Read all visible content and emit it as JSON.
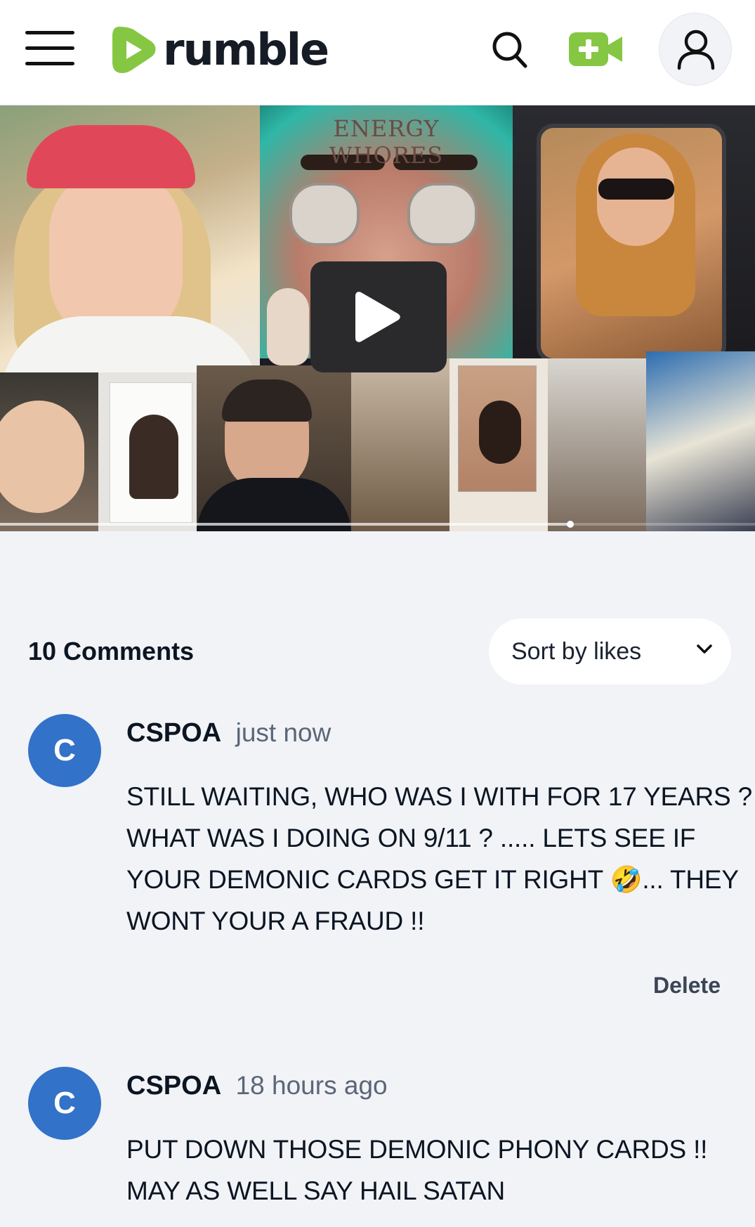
{
  "header": {
    "logo_text": "rumble",
    "brand_color": "#85c742",
    "icons": [
      "menu-icon",
      "search-icon",
      "upload-video-icon",
      "user-icon"
    ]
  },
  "video": {
    "thumbnail_caption": "ENERGY WHORES",
    "progress": 0.755
  },
  "comments": {
    "count_label": "10 Comments",
    "sort_selected": "Sort by likes",
    "items": [
      {
        "avatar_letter": "C",
        "username": "CSPOA",
        "time": "just now",
        "text": "STILL WAITING, WHO WAS I WITH FOR 17 YEARS ? WHAT WAS I DOING ON 9/11 ? ..... LETS SEE IF YOUR DEMONIC CARDS GET IT RIGHT 🤣... THEY WONT YOUR A FRAUD !!",
        "delete_label": "Delete"
      },
      {
        "avatar_letter": "C",
        "username": "CSPOA",
        "time": "18 hours ago",
        "text": "PUT DOWN THOSE DEMONIC PHONY CARDS !! MAY AS WELL SAY HAIL SATAN"
      }
    ]
  },
  "colors": {
    "background": "#f1f3f7",
    "avatar": "#3272c8",
    "brand_green": "#85c742"
  }
}
